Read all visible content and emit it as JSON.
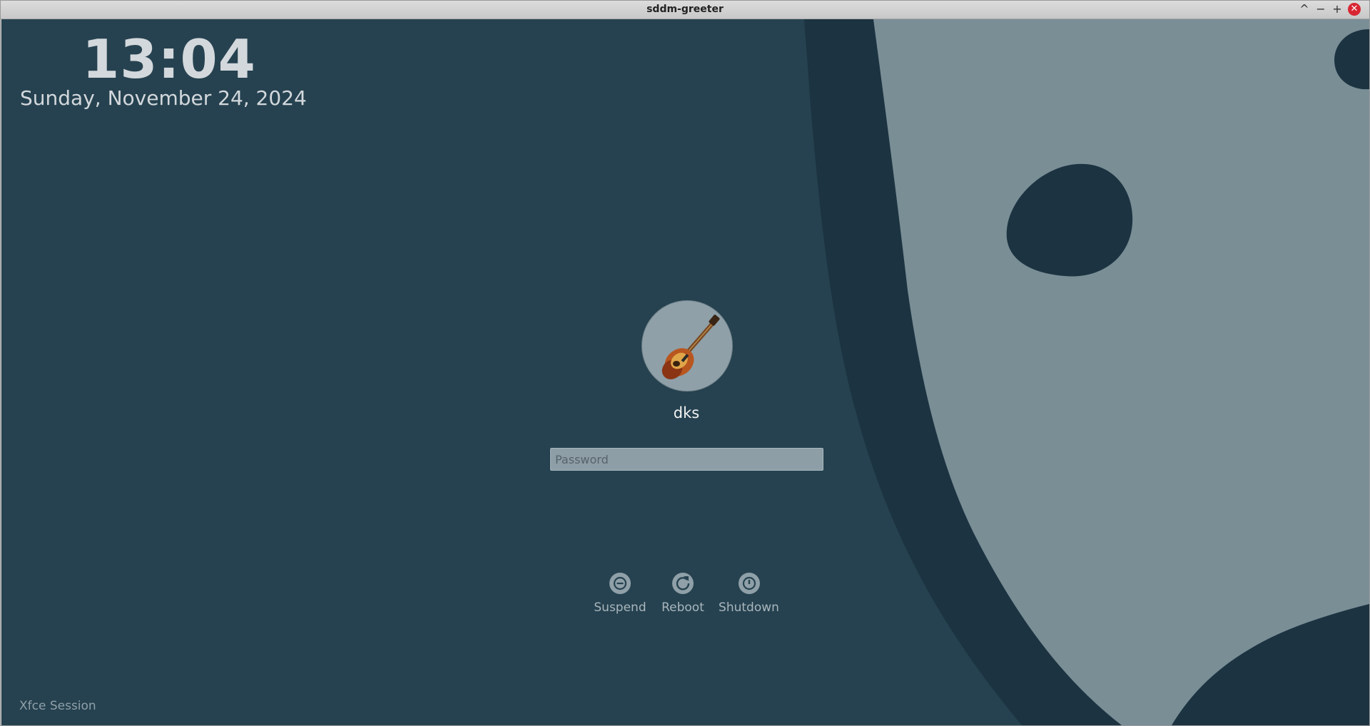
{
  "window": {
    "title": "sddm-greeter",
    "buttons": {
      "shade": "^",
      "minimize": "−",
      "maximize": "+",
      "close": "✕"
    }
  },
  "clock": {
    "time": "13:04",
    "date": "Sunday, November 24, 2024"
  },
  "user": {
    "name": "dks",
    "avatar_icon": "guitar-icon"
  },
  "password": {
    "placeholder": "Password",
    "value": ""
  },
  "power": {
    "suspend_label": "Suspend",
    "reboot_label": "Reboot",
    "shutdown_label": "Shutdown"
  },
  "session": {
    "label": "Xfce Session"
  },
  "colors": {
    "background": "#264250",
    "wallpaper_dark": "#1c3341",
    "wallpaper_light": "#7a8e96",
    "text": "#d3d8dc",
    "close_button": "#d82733"
  }
}
